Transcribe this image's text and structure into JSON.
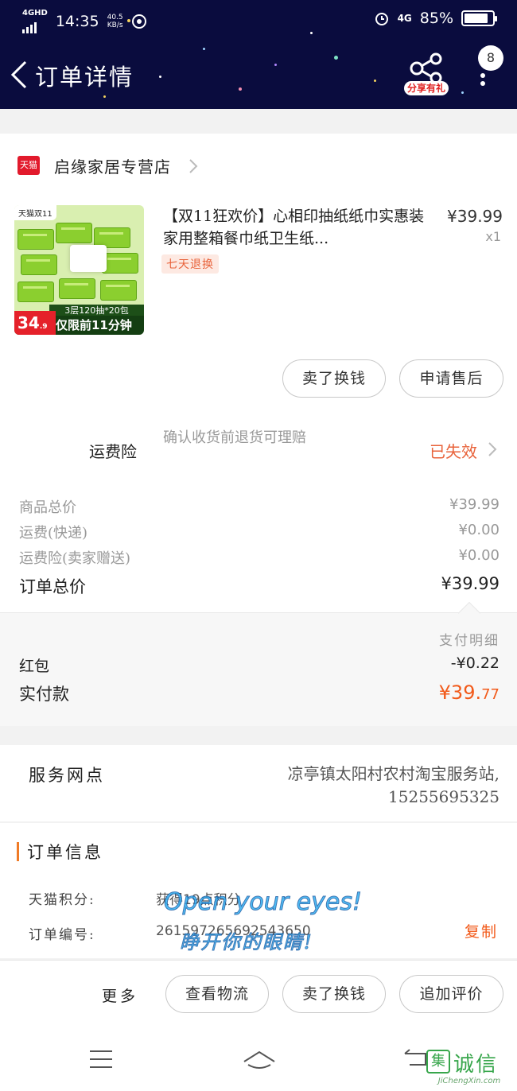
{
  "status_bar": {
    "network_type": "4G",
    "network_sub": "HD",
    "time": "14:35",
    "speed_value": "40.5",
    "speed_unit": "KB/s",
    "right_network": "4G",
    "battery": "85%",
    "battery_level": 0.85
  },
  "header": {
    "title": "订单详情",
    "share_label": "分享有礼",
    "message_count": "8",
    "bg_color": "#0a0c3e"
  },
  "shop": {
    "logo_text": "天猫",
    "name": "启缘家居专营店"
  },
  "product": {
    "image_tag": "天猫双11",
    "image_bar_text": "3层120抽*20包",
    "image_bottom_text": "仅限前11分钟",
    "image_price_main": "34",
    "image_price_sub": ".9",
    "title": "【双11狂欢价】心相印抽纸纸巾实惠装家用整箱餐巾纸卫生纸...",
    "price": "¥39.99",
    "quantity": "x1",
    "return_tag": "七天退换"
  },
  "product_actions": {
    "sell_label": "卖了换钱",
    "after_sale_label": "申请售后"
  },
  "insurance": {
    "label": "运费险",
    "description": "确认收货前退货可理赔",
    "status": "已失效",
    "status_color": "#e8623a"
  },
  "fees": [
    {
      "label": "商品总价",
      "value": "¥39.99"
    },
    {
      "label": "运费(快递)",
      "value": "¥0.00"
    },
    {
      "label": "运费险(卖家赠送)",
      "value": "¥0.00"
    }
  ],
  "order_total": {
    "label": "订单总价",
    "value": "¥39.99"
  },
  "payment": {
    "detail_label": "支付明细",
    "red_packet_label": "红包",
    "red_packet_value": "-¥0.22",
    "actual_label": "实付款",
    "actual_value_main": "¥39.",
    "actual_value_cents": "77",
    "accent_color": "#f25a1a"
  },
  "service": {
    "label": "服务网点",
    "value_line1": "凉亭镇太阳村农村淘宝服务站,",
    "value_line2": "15255695325"
  },
  "order_info": {
    "title": "订单信息",
    "points_label": "天猫积分:",
    "points_value": "获得19点积分",
    "order_no_label": "订单编号:",
    "order_no_value": "261597265692543650",
    "copy_label": "复制"
  },
  "overlay": {
    "line1": "Open your eyes!",
    "line2": "睁开你的眼睛!"
  },
  "bottom_actions": {
    "more_label": "更多",
    "logistics_label": "查看物流",
    "sell_label": "卖了换钱",
    "review_label": "追加评价"
  },
  "watermark": {
    "badge": "集",
    "text": "诚信",
    "url": "JiChengXin.com"
  }
}
